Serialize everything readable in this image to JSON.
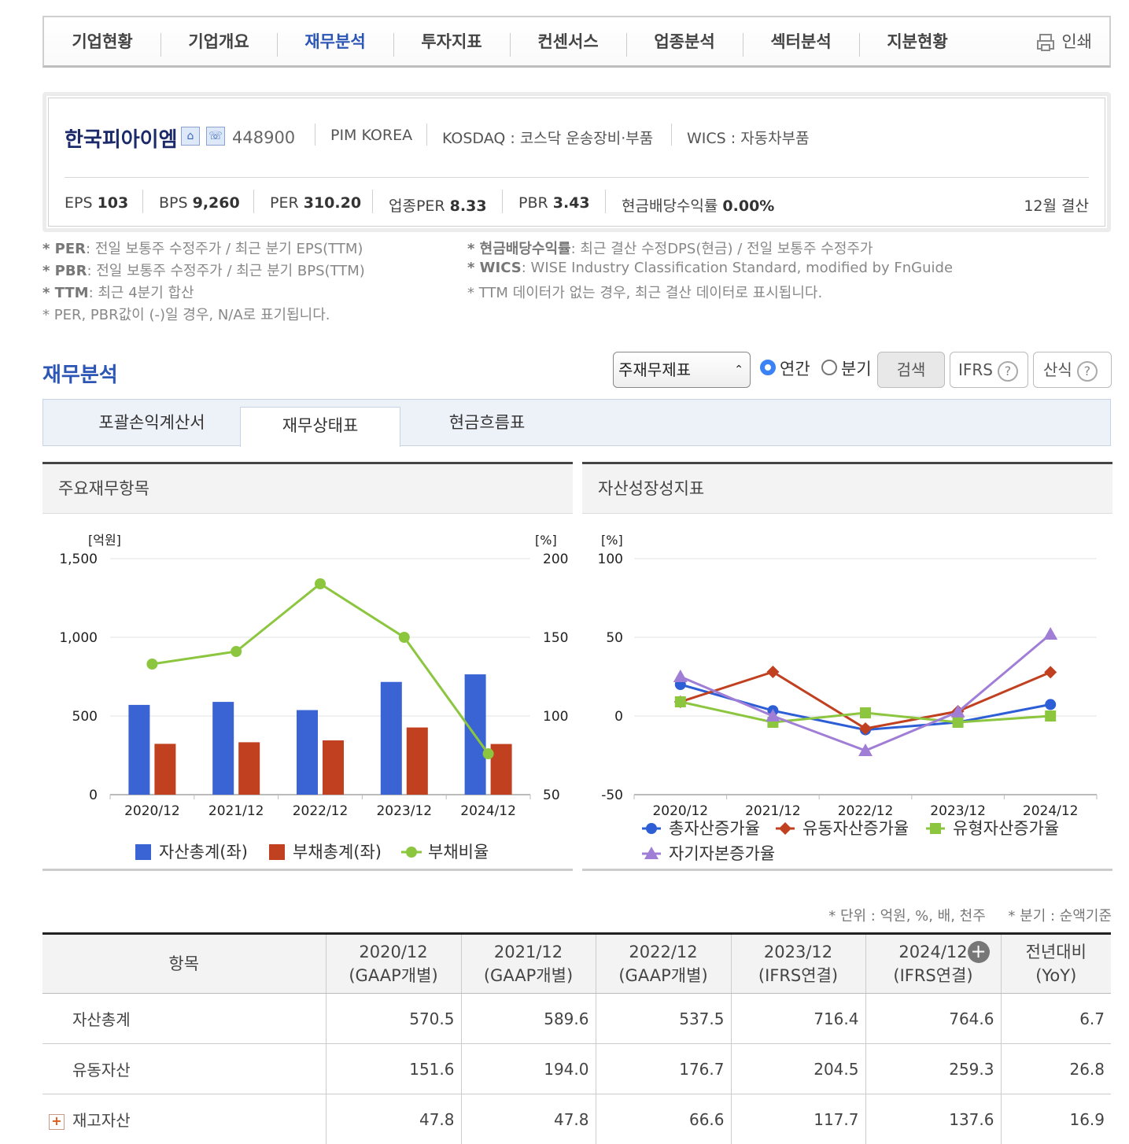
{
  "nav": {
    "items": [
      "기업현황",
      "기업개요",
      "재무분석",
      "투자지표",
      "컨센서스",
      "업종분석",
      "섹터분석",
      "지분현황"
    ],
    "active_index": 2,
    "print_label": "인쇄"
  },
  "company": {
    "name": "한국피아이엠",
    "code": "448900",
    "english_name": "PIM KOREA",
    "market": "KOSDAQ : 코스닥 운송장비·부품",
    "wics": "WICS : 자동차부품",
    "metrics": [
      {
        "label": "EPS",
        "value": "103"
      },
      {
        "label": "BPS",
        "value": "9,260"
      },
      {
        "label": "PER",
        "value": "310.20"
      },
      {
        "label": "업종PER",
        "value": "8.33"
      },
      {
        "label": "PBR",
        "value": "3.43"
      },
      {
        "label": "현금배당수익률",
        "value": "0.00%"
      }
    ],
    "fiscal": "12월 결산"
  },
  "notes": {
    "left": [
      {
        "key": "* PER",
        "text": ": 전일 보통주 수정주가 / 최근 분기 EPS(TTM)"
      },
      {
        "key": "* PBR",
        "text": ": 전일 보통주 수정주가 / 최근 분기 BPS(TTM)"
      },
      {
        "key": "* TTM",
        "text": ": 최근 4분기 합산"
      },
      {
        "key": "",
        "text": "* PER, PBR값이 (-)일 경우, N/A로 표기됩니다."
      }
    ],
    "right": [
      {
        "key": "* 현금배당수익률",
        "text": ": 최근 결산 수정DPS(현금) / 전일 보통주 수정주가"
      },
      {
        "key": "* WICS",
        "text": ": WISE Industry Classification Standard, modified by FnGuide"
      },
      {
        "key": "",
        "text": "* TTM 데이터가 없는 경우, 최근 결산 데이터로 표시됩니다."
      }
    ]
  },
  "section": {
    "title": "재무분석",
    "select_value": "주재무제표",
    "radio_annual": "연간",
    "radio_quarter": "분기",
    "search_label": "검색",
    "ifrs_label": "IFRS",
    "formula_label": "산식",
    "tabs": [
      "포괄손익계산서",
      "재무상태표",
      "현금흐름표"
    ],
    "active_tab": 1
  },
  "panels": {
    "left_title": "주요재무항목",
    "right_title": "자산성장성지표"
  },
  "chart_data": [
    {
      "type": "bar",
      "categories": [
        "2020/12",
        "2021/12",
        "2022/12",
        "2023/12",
        "2024/12"
      ],
      "y_left_unit": "[억원]",
      "y_right_unit": "[%]",
      "ylim_left": [
        0,
        1500
      ],
      "ylim_right": [
        50,
        200
      ],
      "yticks_left": [
        "0",
        "500",
        "1,000",
        "1,500"
      ],
      "yticks_right": [
        "50",
        "100",
        "150",
        "200"
      ],
      "series": [
        {
          "name": "자산총계(좌)",
          "kind": "bar",
          "axis": "left",
          "color": "#3a64d4",
          "values": [
            570.5,
            589.6,
            537.5,
            716.4,
            764.6
          ]
        },
        {
          "name": "부채총계(좌)",
          "kind": "bar",
          "axis": "left",
          "color": "#c0401f",
          "values": [
            323,
            333,
            345,
            427,
            322
          ]
        },
        {
          "name": "부채비율",
          "kind": "line",
          "axis": "right",
          "color": "#8cc63f",
          "values": [
            133,
            141,
            184,
            150,
            76
          ]
        }
      ],
      "legend": "bottom",
      "grid": true
    },
    {
      "type": "line",
      "categories": [
        "2020/12",
        "2021/12",
        "2022/12",
        "2023/12",
        "2024/12"
      ],
      "y_unit": "[%]",
      "ylim": [
        -50,
        100
      ],
      "yticks": [
        "-50",
        "0",
        "50",
        "100"
      ],
      "series": [
        {
          "name": "총자산증가율",
          "color": "#2d5ed6",
          "marker": "circle",
          "values": [
            20,
            3.4,
            -8.8,
            -4,
            7.3
          ]
        },
        {
          "name": "유동자산증가율",
          "color": "#c0401f",
          "marker": "diamond",
          "values": [
            9,
            28,
            -8,
            3,
            27.8
          ]
        },
        {
          "name": "유형자산증가율",
          "color": "#8cc63f",
          "marker": "square",
          "values": [
            9,
            -4,
            2,
            -4,
            0
          ]
        },
        {
          "name": "자기자본증가율",
          "color": "#a07ed6",
          "marker": "triangle",
          "values": [
            25,
            0,
            -22,
            2.6,
            52
          ]
        }
      ],
      "legend": "bottom",
      "grid": true
    }
  ],
  "table": {
    "units": "* 단위 : 억원, %, 배, 천주     * 분기 : 순액기준",
    "headers": [
      {
        "l1": "항목",
        "l2": ""
      },
      {
        "l1": "2020/12",
        "l2": "(GAAP개별)"
      },
      {
        "l1": "2021/12",
        "l2": "(GAAP개별)"
      },
      {
        "l1": "2022/12",
        "l2": "(GAAP개별)"
      },
      {
        "l1": "2023/12",
        "l2": "(IFRS연결)"
      },
      {
        "l1": "2024/12",
        "l2": "(IFRS연결)"
      },
      {
        "l1": "전년대비",
        "l2": "(YoY)"
      }
    ],
    "rows": [
      {
        "label": "자산총계",
        "expand": false,
        "values": [
          "570.5",
          "589.6",
          "537.5",
          "716.4",
          "764.6",
          "6.7"
        ]
      },
      {
        "label": "유동자산",
        "expand": false,
        "values": [
          "151.6",
          "194.0",
          "176.7",
          "204.5",
          "259.3",
          "26.8"
        ]
      },
      {
        "label": "재고자산",
        "expand": true,
        "values": [
          "47.8",
          "47.8",
          "66.6",
          "117.7",
          "137.6",
          "16.9"
        ]
      }
    ]
  }
}
